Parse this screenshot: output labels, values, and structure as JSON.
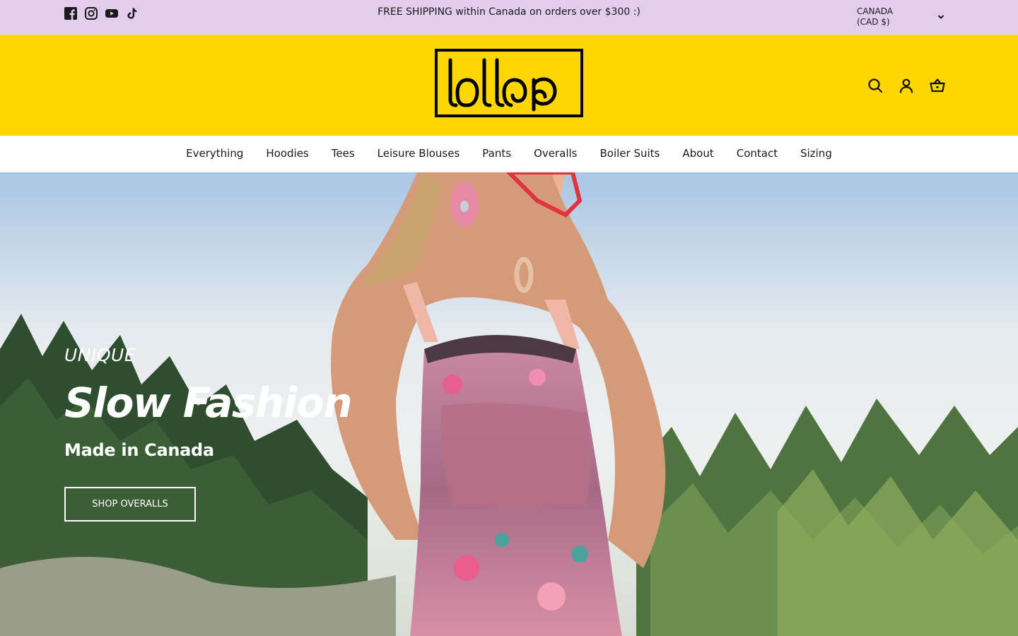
{
  "announcement": {
    "social_icons": [
      "facebook-icon",
      "instagram-icon",
      "youtube-icon",
      "tiktok-icon"
    ],
    "text": "FREE SHIPPING within Canada on orders over $300 :)",
    "currency_line1": "CANADA",
    "currency_line2": "(CAD $)",
    "background": "#e2cdef"
  },
  "header": {
    "logo_text": "lollop",
    "background": "#ffd600",
    "icons": [
      "search-icon",
      "account-icon",
      "cart-icon"
    ]
  },
  "nav": {
    "items": [
      "Everything",
      "Hoodies",
      "Tees",
      "Leisure Blouses",
      "Pants",
      "Overalls",
      "Boiler Suits",
      "About",
      "Contact",
      "Sizing"
    ]
  },
  "hero": {
    "eyebrow": "UNIQUE",
    "headline": "Slow Fashion",
    "subhead": "Made in Canada",
    "cta_label": "SHOP OVERALLS"
  }
}
